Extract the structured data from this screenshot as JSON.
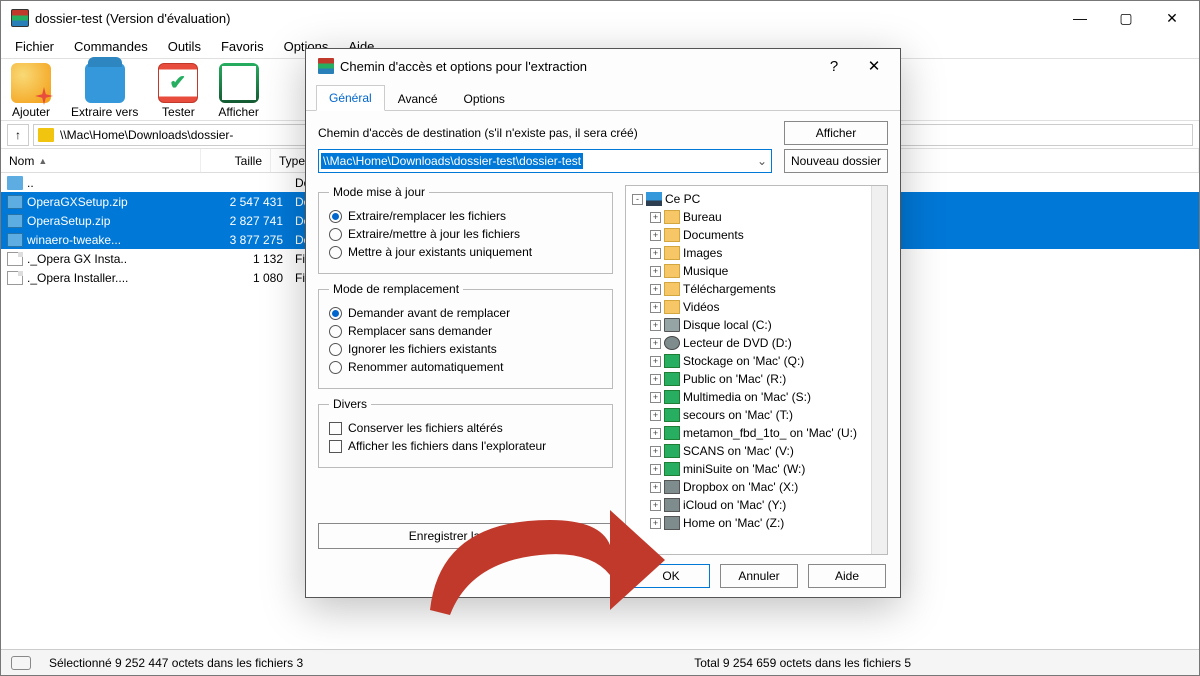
{
  "window": {
    "title": "dossier-test (Version d'évaluation)"
  },
  "menu": [
    "Fichier",
    "Commandes",
    "Outils",
    "Favoris",
    "Options",
    "Aide"
  ],
  "toolbar": [
    {
      "name": "add",
      "label": "Ajouter"
    },
    {
      "name": "extract",
      "label": "Extraire vers"
    },
    {
      "name": "test",
      "label": "Tester"
    },
    {
      "name": "view",
      "label": "Afficher"
    }
  ],
  "address_path": "\\\\Mac\\Home\\Downloads\\dossier-",
  "columns": {
    "nom": "Nom",
    "taille": "Taille",
    "type": "Type"
  },
  "files": [
    {
      "name": "..",
      "size": "",
      "type": "Dossier sy",
      "icon": "folder",
      "sel": false
    },
    {
      "name": "OperaGXSetup.zip",
      "size": "2 547 431",
      "type": "Dossier co",
      "icon": "zip",
      "sel": true
    },
    {
      "name": "OperaSetup.zip",
      "size": "2 827 741",
      "type": "Dossier co",
      "icon": "zip",
      "sel": true
    },
    {
      "name": "winaero-tweake...",
      "size": "3 877 275",
      "type": "Dossier co",
      "icon": "zip",
      "sel": true
    },
    {
      "name": "._Opera GX Insta..",
      "size": "1 132",
      "type": "Fichier AP",
      "icon": "file",
      "sel": false
    },
    {
      "name": "._Opera Installer....",
      "size": "1 080",
      "type": "Fichier AP",
      "icon": "file",
      "sel": false
    }
  ],
  "status_left": "Sélectionné 9 252 447 octets dans les fichiers 3",
  "status_right": "Total 9 254 659 octets dans les fichiers 5",
  "dialog": {
    "title": "Chemin d'accès et options pour l'extraction",
    "tabs": [
      "Général",
      "Avancé",
      "Options"
    ],
    "active_tab": 0,
    "dest_label": "Chemin d'accès de destination (s'il n'existe pas, il sera créé)",
    "btn_show": "Afficher",
    "btn_newfolder": "Nouveau dossier",
    "dest_path": "\\\\Mac\\Home\\Downloads\\dossier-test\\dossier-test",
    "group_update": {
      "legend": "Mode mise à jour",
      "opts": [
        "Extraire/remplacer les fichiers",
        "Extraire/mettre à jour les fichiers",
        "Mettre à jour existants uniquement"
      ],
      "selected": 0
    },
    "group_overwrite": {
      "legend": "Mode de remplacement",
      "opts": [
        "Demander avant de remplacer",
        "Remplacer sans demander",
        "Ignorer les fichiers existants",
        "Renommer automatiquement"
      ],
      "selected": 0
    },
    "group_misc": {
      "legend": "Divers",
      "opts": [
        "Conserver les fichiers altérés",
        "Afficher les fichiers dans l'explorateur"
      ]
    },
    "save_config": "Enregistrer la configu",
    "tree": [
      {
        "d": 0,
        "exp": "-",
        "icon": "pc",
        "label": "Ce PC"
      },
      {
        "d": 1,
        "exp": "+",
        "icon": "folder",
        "label": "Bureau"
      },
      {
        "d": 1,
        "exp": "+",
        "icon": "folder",
        "label": "Documents"
      },
      {
        "d": 1,
        "exp": "+",
        "icon": "folder",
        "label": "Images"
      },
      {
        "d": 1,
        "exp": "+",
        "icon": "folder",
        "label": "Musique"
      },
      {
        "d": 1,
        "exp": "+",
        "icon": "folder",
        "label": "Téléchargements"
      },
      {
        "d": 1,
        "exp": "+",
        "icon": "folder",
        "label": "Vidéos"
      },
      {
        "d": 1,
        "exp": "+",
        "icon": "disk",
        "label": "Disque local (C:)"
      },
      {
        "d": 1,
        "exp": "+",
        "icon": "dvd",
        "label": "Lecteur de DVD (D:)"
      },
      {
        "d": 1,
        "exp": "+",
        "icon": "net",
        "label": "Stockage on 'Mac' (Q:)"
      },
      {
        "d": 1,
        "exp": "+",
        "icon": "net",
        "label": "Public on 'Mac' (R:)"
      },
      {
        "d": 1,
        "exp": "+",
        "icon": "net",
        "label": "Multimedia on 'Mac' (S:)"
      },
      {
        "d": 1,
        "exp": "+",
        "icon": "net",
        "label": "secours on 'Mac' (T:)"
      },
      {
        "d": 1,
        "exp": "+",
        "icon": "net",
        "label": "metamon_fbd_1to_ on 'Mac' (U:)"
      },
      {
        "d": 1,
        "exp": "+",
        "icon": "net",
        "label": "SCANS on 'Mac' (V:)"
      },
      {
        "d": 1,
        "exp": "+",
        "icon": "net",
        "label": "miniSuite on 'Mac' (W:)"
      },
      {
        "d": 1,
        "exp": "+",
        "icon": "netg",
        "label": "Dropbox on 'Mac' (X:)"
      },
      {
        "d": 1,
        "exp": "+",
        "icon": "netg",
        "label": "iCloud on 'Mac' (Y:)"
      },
      {
        "d": 1,
        "exp": "+",
        "icon": "netg",
        "label": "Home on 'Mac' (Z:)"
      }
    ],
    "btn_ok": "OK",
    "btn_cancel": "Annuler",
    "btn_help": "Aide"
  }
}
